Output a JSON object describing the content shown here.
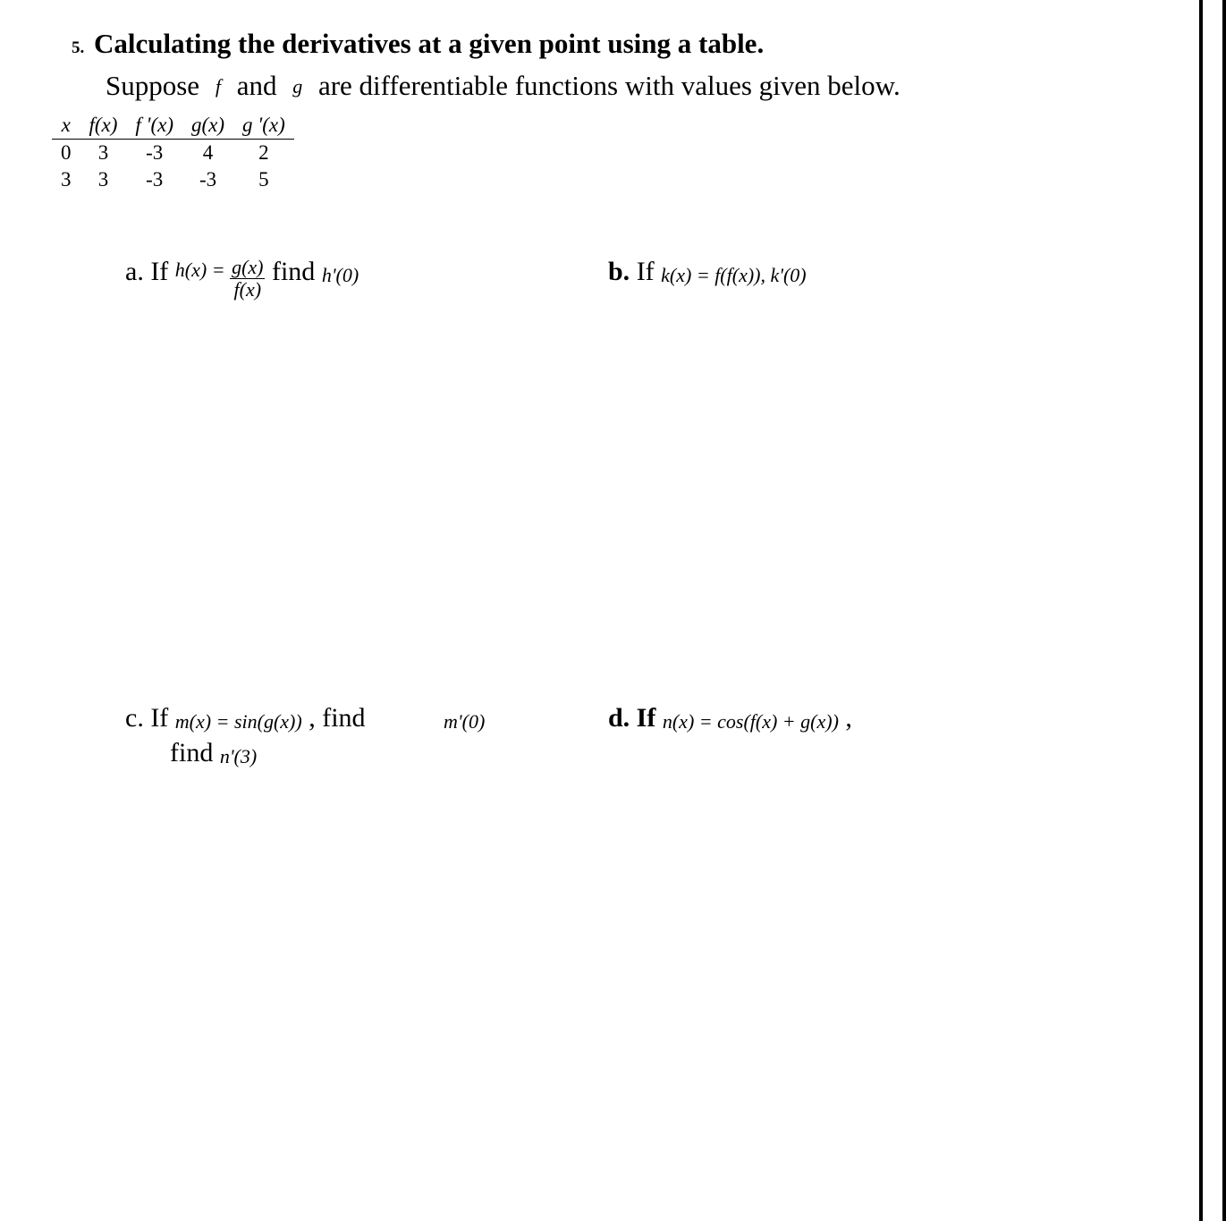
{
  "problem_number": "5.",
  "title": "Calculating the derivatives at a given point using a table.",
  "intro_prefix": "Suppose ",
  "intro_f": "f",
  "intro_and": " and ",
  "intro_g": "g",
  "intro_suffix": " are differentiable functions with values given below.",
  "table": {
    "headers": [
      "x",
      "f(x)",
      "f '(x)",
      "g(x)",
      "g '(x)"
    ],
    "rows": [
      [
        "0",
        "3",
        "-3",
        "4",
        "2"
      ],
      [
        "3",
        "3",
        "-3",
        "-3",
        "5"
      ]
    ]
  },
  "parts": {
    "a": {
      "label": "a. If ",
      "hx_prefix": "h(x) = ",
      "frac_num": "g(x)",
      "frac_den": "f(x)",
      "find_word": "  find   ",
      "target": "h'(0)"
    },
    "b": {
      "label": "b.",
      "if_word": "  If   ",
      "eq": "k(x) = f(f(x)),   k'(0)"
    },
    "c": {
      "label": "c. If  ",
      "eq": "m(x) = sin(g(x))",
      "comma_find": " ,   find",
      "target": "m'(0)"
    },
    "d": {
      "label": "d.   If  ",
      "eq": "n(x) = cos(f(x) + g(x))",
      "comma": " ,",
      "find_word": "find   ",
      "target": "n'(3)"
    }
  }
}
